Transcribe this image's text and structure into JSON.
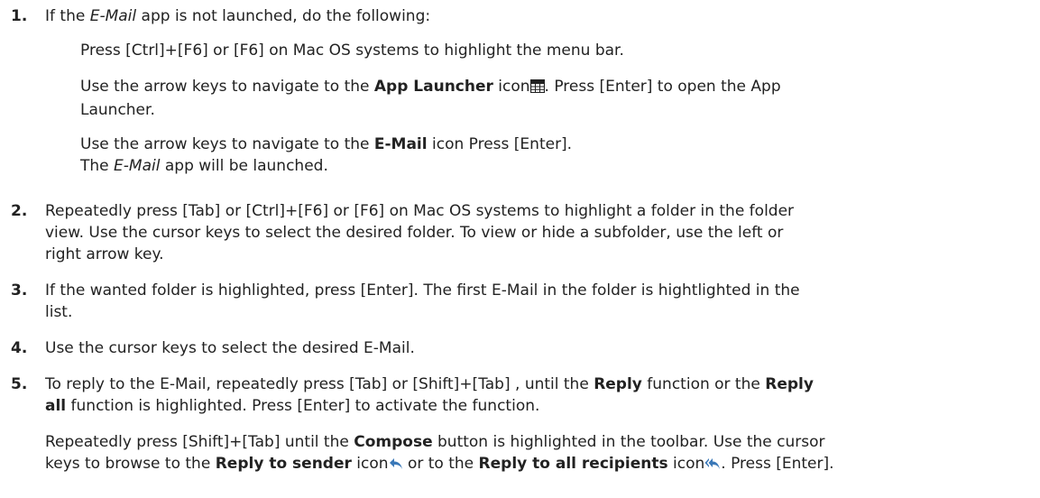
{
  "steps": [
    {
      "number": "1.",
      "intro": {
        "a": "If the ",
        "app": "E-Mail",
        "b": " app is not launched, do the following:"
      },
      "sub1": "Press [Ctrl]+[F6] or [F6] on Mac OS systems to highlight the menu bar.",
      "sub2": {
        "a": "Use the arrow keys to navigate to the ",
        "bold": "App Launcher",
        "b": " icon",
        "c": ". Press [Enter] to open the App",
        "d": "Launcher.",
        "icon": "grid-icon"
      },
      "sub3": {
        "a": "Use the arrow keys to navigate to the ",
        "bold": "E-Mail",
        "b": " icon Press [Enter]."
      },
      "sub4": {
        "a": "The ",
        "app": "E-Mail",
        "b": " app will be launched."
      }
    },
    {
      "number": "2.",
      "line1": "Repeatedly press [Tab] or [Ctrl]+[F6] or [F6] on Mac OS systems to highlight a folder in the folder",
      "line2": "view. Use the cursor keys to select the desired folder. To view or hide a subfolder, use the left or",
      "line3": "right arrow key."
    },
    {
      "number": "3.",
      "line1": "If the wanted folder is highlighted, press [Enter]. The first E-Mail in the folder is hightlighted in the",
      "line2": "list."
    },
    {
      "number": "4.",
      "line1": "Use the cursor keys to select the desired E-Mail."
    },
    {
      "number": "5.",
      "p1": {
        "a": "To reply to the E-Mail, repeatedly press [Tab] or [Shift]+[Tab] , until the ",
        "bold1": "Reply",
        "b": " function or the ",
        "bold2": "Reply",
        "bold3": "all",
        "c": " function is highlighted. Press [Enter] to activate the function."
      },
      "p2": {
        "a": "Repeatedly press [Shift]+[Tab] until the ",
        "bold1": "Compose",
        "b": " button is highlighted in the toolbar. Use the cursor",
        "c": "keys to browse to the ",
        "bold2": "Reply to sender",
        "d": " icon",
        "e": " or to the ",
        "bold3": "Reply to all recipients",
        "f": " icon",
        "g": ". Press [Enter].",
        "icon1": "reply-icon",
        "icon2": "reply-all-icon"
      }
    }
  ],
  "colors": {
    "text": "#222222",
    "icon_blue": "#3a78b8"
  }
}
